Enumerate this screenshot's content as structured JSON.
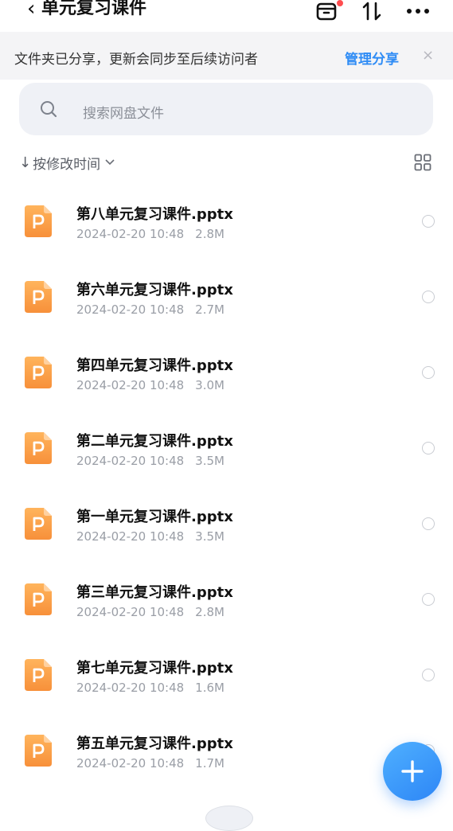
{
  "header": {
    "back_icon": "chevron-left-icon",
    "title": "单元复习课件",
    "icons": [
      "recycle-bin-icon",
      "sort-transfer-icon",
      "more-icon"
    ],
    "accent_color": "#ff4d4f"
  },
  "banner": {
    "text": "文件夹已分享，更新会同步至后续访问者",
    "link_label": "管理分享",
    "close_label": "×",
    "link_color": "#2f8cf5"
  },
  "search": {
    "placeholder": "搜索网盘文件"
  },
  "sort": {
    "arrow": "↓",
    "label": "按修改时间",
    "chevron": "⌵"
  },
  "files": [
    {
      "name": "第八单元复习课件.pptx",
      "date": "2024-02-20 10:48",
      "size": "2.8M"
    },
    {
      "name": "第六单元复习课件.pptx",
      "date": "2024-02-20 10:48",
      "size": "2.7M"
    },
    {
      "name": "第四单元复习课件.pptx",
      "date": "2024-02-20 10:48",
      "size": "3.0M"
    },
    {
      "name": "第二单元复习课件.pptx",
      "date": "2024-02-20 10:48",
      "size": "3.5M"
    },
    {
      "name": "第一单元复习课件.pptx",
      "date": "2024-02-20 10:48",
      "size": "3.5M"
    },
    {
      "name": "第三单元复习课件.pptx",
      "date": "2024-02-20 10:48",
      "size": "2.8M"
    },
    {
      "name": "第七单元复习课件.pptx",
      "date": "2024-02-20 10:48",
      "size": "1.6M"
    },
    {
      "name": "第五单元复习课件.pptx",
      "date": "2024-02-20 10:48",
      "size": "1.7M"
    }
  ],
  "file_icon": "ppt-file-icon",
  "fab": {
    "icon": "plus-icon",
    "color": "#2d86f6"
  }
}
